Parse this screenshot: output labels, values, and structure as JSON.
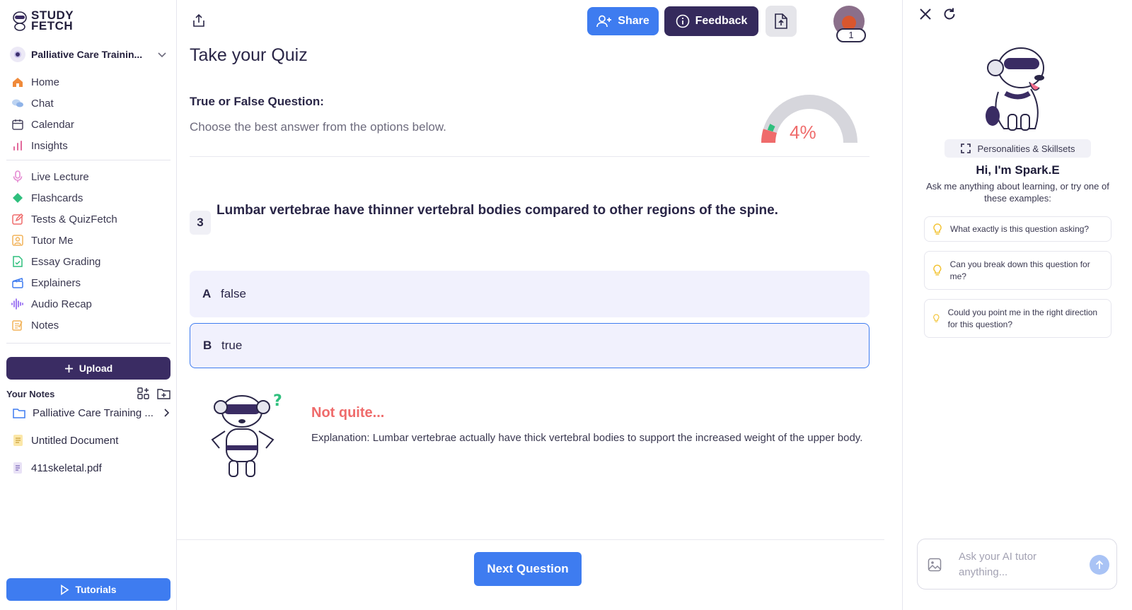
{
  "brand": {
    "line1": "STUDY",
    "line2": "FETCH"
  },
  "course": {
    "label": "Palliative Care Trainin..."
  },
  "nav": {
    "primary": [
      {
        "label": "Home",
        "icon": "home-icon",
        "color": "#f08a3a"
      },
      {
        "label": "Chat",
        "icon": "chat-icon",
        "color": "#8fb3e8"
      },
      {
        "label": "Calendar",
        "icon": "calendar-icon",
        "color": "#4a4760"
      },
      {
        "label": "Insights",
        "icon": "insights-icon",
        "color": "#e26a9c"
      }
    ],
    "tools": [
      {
        "label": "Live Lecture",
        "icon": "microphone-icon",
        "color": "#e58bd2"
      },
      {
        "label": "Flashcards",
        "icon": "flashcards-icon",
        "color": "#2fbf7d"
      },
      {
        "label": "Tests & QuizFetch",
        "icon": "pencil-icon",
        "color": "#ef6b6b"
      },
      {
        "label": "Tutor Me",
        "icon": "tutor-icon",
        "color": "#f2b35a"
      },
      {
        "label": "Essay Grading",
        "icon": "essay-icon",
        "color": "#2fbf7d"
      },
      {
        "label": "Explainers",
        "icon": "clapper-icon",
        "color": "#3e7cf0"
      },
      {
        "label": "Audio Recap",
        "icon": "audio-wave-icon",
        "color": "#8a5cf0"
      },
      {
        "label": "Notes",
        "icon": "notes-icon",
        "color": "#f2b35a"
      }
    ]
  },
  "sidebar": {
    "upload_label": "Upload",
    "your_notes_label": "Your Notes",
    "notes": [
      {
        "label": "Palliative Care Training ...",
        "icon": "folder-icon"
      },
      {
        "label": "Untitled Document",
        "icon": "document-icon"
      },
      {
        "label": "411skeletal.pdf",
        "icon": "pdf-icon"
      }
    ],
    "tutorials_label": "Tutorials"
  },
  "header": {
    "share_label": "Share",
    "feedback_label": "Feedback",
    "avatar_count": "1"
  },
  "quiz": {
    "title": "Take your Quiz",
    "question_type": "True or False Question:",
    "instruction": "Choose the best answer from the options below.",
    "progress_percent": 4,
    "progress_label": "4%",
    "question_number": "3",
    "question_text": "Lumbar vertebrae have thinner vertebral bodies compared to other regions of the spine.",
    "options": [
      {
        "letter": "A",
        "text": "false"
      },
      {
        "letter": "B",
        "text": "true"
      }
    ],
    "selected_option": "B",
    "feedback_title": "Not quite...",
    "feedback_text": "Explanation: Lumbar vertebrae actually have thick vertebral bodies to support the increased weight of the upper body.",
    "next_label": "Next Question"
  },
  "tutor": {
    "skills_label": "Personalities & Skillsets",
    "greeting": "Hi, I'm Spark.E",
    "intro": "Ask me anything about learning, or try one of these examples:",
    "suggestions": [
      "What exactly is this question asking?",
      "Can you break down this question for me?",
      "Could you point me in the right direction for this question?"
    ],
    "input_placeholder": "Ask your AI tutor anything..."
  },
  "colors": {
    "primary_blue": "#3e7cf0",
    "dark_purple": "#352a5c",
    "incorrect_red": "#ef6b6b",
    "option_bg": "#f1f1fd"
  }
}
